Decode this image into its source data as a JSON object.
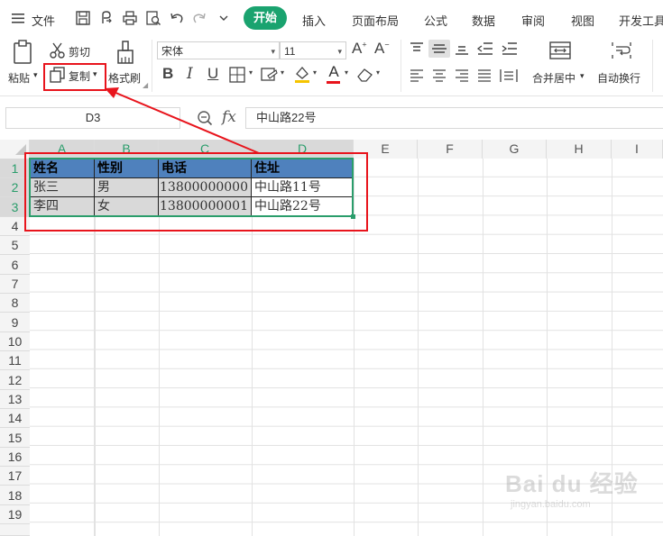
{
  "menubar": {
    "file_label": "文件",
    "tabs": [
      "开始",
      "插入",
      "页面布局",
      "公式",
      "数据",
      "审阅",
      "视图",
      "开发工具"
    ]
  },
  "ribbon": {
    "paste_label": "粘贴",
    "cut_label": "剪切",
    "copy_label": "复制",
    "format_painter_label": "格式刷",
    "font_name": "宋体",
    "font_size": "11",
    "merge_center_label": "合并居中",
    "wrap_text_label": "自动换行"
  },
  "formula_bar": {
    "cell_ref": "D3",
    "fx_label": "fx",
    "content": "中山路22号"
  },
  "grid": {
    "columns": [
      "A",
      "B",
      "C",
      "D",
      "E",
      "F",
      "G",
      "H",
      "I"
    ],
    "rows": [
      "1",
      "2",
      "3",
      "4",
      "5",
      "6",
      "7",
      "8",
      "9",
      "10",
      "11",
      "12",
      "13",
      "14",
      "15",
      "16",
      "17",
      "18",
      "19"
    ],
    "table": {
      "header": [
        "姓名",
        "性别",
        "电话",
        "住址"
      ],
      "rows": [
        [
          "张三",
          "男",
          "13800000000",
          "中山路11号"
        ],
        [
          "李四",
          "女",
          "13800000001",
          "中山路22号"
        ]
      ]
    }
  },
  "colors": {
    "accent": "#1aa36f",
    "header_fill": "#4f81bd",
    "data_fill": "#d9d9d9",
    "selection_border": "#2a9d6b",
    "annotation_red": "#e8141c"
  },
  "watermark": {
    "brand": "Bai du 经验",
    "url": "jingyan.baidu.com"
  }
}
